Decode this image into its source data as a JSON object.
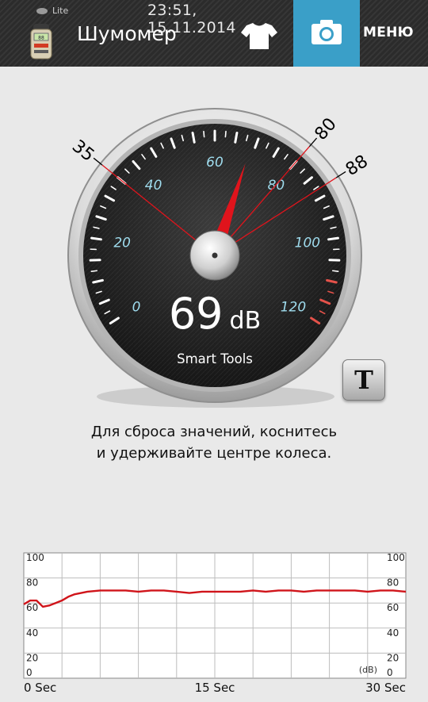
{
  "status_bar": {
    "time": "23:51, 15.11.2014"
  },
  "header": {
    "lite_label": "Lite",
    "title": "Шумомер",
    "menu_label": "МЕНЮ",
    "icons": [
      "sound-meter-app-icon",
      "tshirt-icon",
      "camera-icon"
    ],
    "camera_button_color": "#3a9fc8"
  },
  "gauge": {
    "current_value": 69,
    "reading": "69 dB",
    "brand": "Smart Tools",
    "scale_labels": [
      "0",
      "20",
      "40",
      "60",
      "80",
      "100",
      "120"
    ],
    "min_marker": "35",
    "max_marker": "80",
    "peak_marker": "88",
    "needle_color": "#e0141c",
    "scale_label_color": "#9fdcee",
    "t_button_label": "T"
  },
  "hint": {
    "line1": "Для сброса значений, коснитесь",
    "line2": "и удерживайте центре колеса."
  },
  "chart_data": {
    "type": "line",
    "ylim": [
      0,
      100
    ],
    "y_ticks_left": [
      "100",
      "80",
      "60",
      "40",
      "20",
      "0"
    ],
    "y_ticks_right": [
      "100",
      "80",
      "60",
      "40",
      "20",
      "0"
    ],
    "x_tick_labels": [
      "0 Sec",
      "15 Sec",
      "30 Sec"
    ],
    "unit_label": "(dB)",
    "grid": true,
    "line_color": "#d0141a",
    "x": [
      0,
      0.5,
      1,
      1.5,
      2,
      2.5,
      3,
      3.5,
      4,
      5,
      6,
      7,
      8,
      9,
      10,
      11,
      12,
      13,
      14,
      15,
      16,
      17,
      18,
      19,
      20,
      21,
      22,
      23,
      24,
      25,
      26,
      27,
      28,
      29,
      30
    ],
    "values": [
      59,
      62,
      62,
      57,
      58,
      60,
      62,
      65,
      67,
      69,
      70,
      70,
      70,
      69,
      70,
      70,
      69,
      68,
      69,
      69,
      69,
      69,
      70,
      69,
      70,
      70,
      69,
      70,
      70,
      70,
      70,
      69,
      70,
      70,
      69
    ]
  }
}
